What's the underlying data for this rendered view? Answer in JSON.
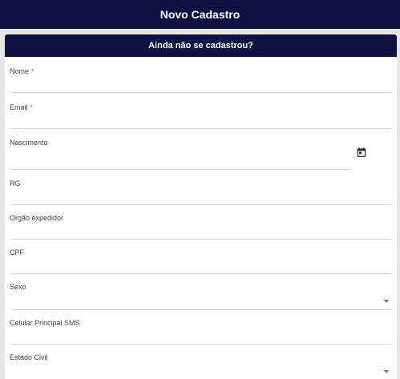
{
  "header": {
    "title": "Novo Cadastro"
  },
  "card": {
    "title": "Ainda não se cadastrou?"
  },
  "form": {
    "nome": {
      "label": "Nome",
      "required": "*"
    },
    "email": {
      "label": "Email",
      "required": "*"
    },
    "nascimento": {
      "label": "Nascimento",
      "icon": "calendar-icon"
    },
    "rg": {
      "label": "RG"
    },
    "orgao": {
      "label": "Orgão expedidor"
    },
    "cpf": {
      "label": "CPF"
    },
    "sexo": {
      "label": "Sexo",
      "icon": "chevron-down-icon"
    },
    "celular": {
      "label": "Celular Principal SMS"
    },
    "estado_civil": {
      "label": "Estado Civil",
      "icon": "chevron-down-icon"
    }
  }
}
